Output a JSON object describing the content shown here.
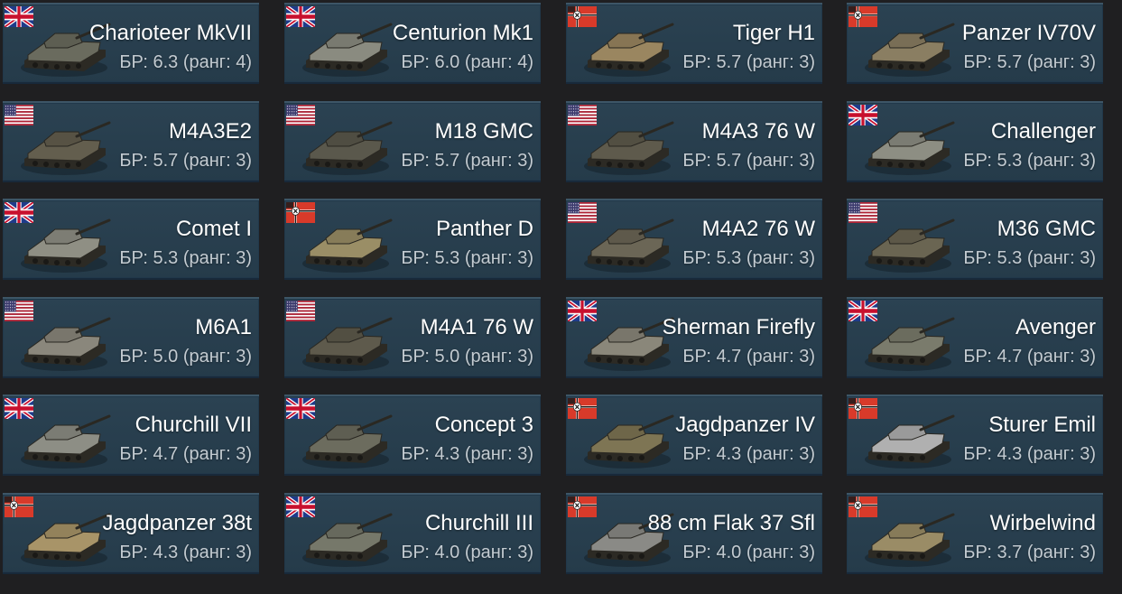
{
  "cards": [
    {
      "name": "Charioteer MkVII",
      "br": "БР: 6.3 (ранг: 4)",
      "nation": "uk",
      "nation_icon": "uk-flag-icon",
      "vehicle_icon": "tank-destroyer-icon",
      "tone": "#6a6b5e"
    },
    {
      "name": "Centurion Mk1",
      "br": "БР: 6.0 (ранг: 4)",
      "nation": "uk",
      "nation_icon": "uk-flag-icon",
      "vehicle_icon": "medium-tank-icon",
      "tone": "#8a8b80"
    },
    {
      "name": "Tiger H1",
      "br": "БР: 5.7 (ранг: 3)",
      "nation": "germany",
      "nation_icon": "german-flag-icon",
      "vehicle_icon": "heavy-tank-icon",
      "tone": "#9a8660"
    },
    {
      "name": "Panzer IV70V",
      "br": "БР: 5.7 (ранг: 3)",
      "nation": "germany",
      "nation_icon": "german-flag-icon",
      "vehicle_icon": "tank-destroyer-icon",
      "tone": "#8a7e62"
    },
    {
      "name": "M4A3E2",
      "br": "БР: 5.7 (ранг: 3)",
      "nation": "usa",
      "nation_icon": "us-flag-icon",
      "vehicle_icon": "heavy-tank-icon",
      "tone": "#635e4e"
    },
    {
      "name": "M18 GMC",
      "br": "БР: 5.7 (ранг: 3)",
      "nation": "usa",
      "nation_icon": "us-flag-icon",
      "vehicle_icon": "tank-destroyer-icon",
      "tone": "#5a584c"
    },
    {
      "name": "M4A3 76 W",
      "br": "БР: 5.7 (ранг: 3)",
      "nation": "usa",
      "nation_icon": "us-flag-icon",
      "vehicle_icon": "medium-tank-icon",
      "tone": "#5e5a4c"
    },
    {
      "name": "Challenger",
      "br": "БР: 5.3 (ранг: 3)",
      "nation": "uk",
      "nation_icon": "uk-flag-icon",
      "vehicle_icon": "tank-destroyer-icon",
      "tone": "#8d8e83"
    },
    {
      "name": "Comet I",
      "br": "БР: 5.3 (ранг: 3)",
      "nation": "uk",
      "nation_icon": "uk-flag-icon",
      "vehicle_icon": "medium-tank-icon",
      "tone": "#8f8f84"
    },
    {
      "name": "Panther D",
      "br": "БР: 5.3 (ранг: 3)",
      "nation": "germany",
      "nation_icon": "german-flag-icon",
      "vehicle_icon": "medium-tank-icon",
      "tone": "#9a8e66"
    },
    {
      "name": "M4A2 76 W",
      "br": "БР: 5.3 (ранг: 3)",
      "nation": "usa",
      "nation_icon": "us-flag-icon",
      "vehicle_icon": "medium-tank-icon",
      "tone": "#6b6656"
    },
    {
      "name": "M36 GMC",
      "br": "БР: 5.3 (ранг: 3)",
      "nation": "usa",
      "nation_icon": "us-flag-icon",
      "vehicle_icon": "tank-destroyer-icon",
      "tone": "#6a6552"
    },
    {
      "name": "M6A1",
      "br": "БР: 5.0 (ранг: 3)",
      "nation": "usa",
      "nation_icon": "us-flag-icon",
      "vehicle_icon": "heavy-tank-icon",
      "tone": "#8a877c"
    },
    {
      "name": "M4A1 76 W",
      "br": "БР: 5.0 (ранг: 3)",
      "nation": "usa",
      "nation_icon": "us-flag-icon",
      "vehicle_icon": "medium-tank-icon",
      "tone": "#5e5a4c"
    },
    {
      "name": "Sherman Firefly",
      "br": "БР: 4.7 (ранг: 3)",
      "nation": "uk",
      "nation_icon": "uk-flag-icon",
      "vehicle_icon": "medium-tank-icon",
      "tone": "#8a877a"
    },
    {
      "name": "Avenger",
      "br": "БР: 4.7 (ранг: 3)",
      "nation": "uk",
      "nation_icon": "uk-flag-icon",
      "vehicle_icon": "tank-destroyer-icon",
      "tone": "#7a7b6c"
    },
    {
      "name": "Churchill VII",
      "br": "БР: 4.7 (ранг: 3)",
      "nation": "uk",
      "nation_icon": "uk-flag-icon",
      "vehicle_icon": "heavy-tank-icon",
      "tone": "#8d8e85"
    },
    {
      "name": "Concept 3",
      "br": "БР: 4.3 (ранг: 3)",
      "nation": "uk",
      "nation_icon": "uk-flag-icon",
      "vehicle_icon": "light-tank-icon",
      "tone": "#6c6c5e"
    },
    {
      "name": "Jagdpanzer IV",
      "br": "БР: 4.3 (ранг: 3)",
      "nation": "germany",
      "nation_icon": "german-flag-icon",
      "vehicle_icon": "tank-destroyer-icon",
      "tone": "#7e7554"
    },
    {
      "name": "Sturer Emil",
      "br": "БР: 4.3 (ранг: 3)",
      "nation": "germany",
      "nation_icon": "german-flag-icon",
      "vehicle_icon": "tank-destroyer-icon",
      "tone": "#b0b0b0"
    },
    {
      "name": "Jagdpanzer 38t",
      "br": "БР: 4.3 (ранг: 3)",
      "nation": "germany",
      "nation_icon": "german-flag-icon",
      "vehicle_icon": "tank-destroyer-icon",
      "tone": "#a89468"
    },
    {
      "name": "Churchill III",
      "br": "БР: 4.0 (ранг: 3)",
      "nation": "uk",
      "nation_icon": "uk-flag-icon",
      "vehicle_icon": "heavy-tank-icon",
      "tone": "#76786a"
    },
    {
      "name": "88 cm Flak 37 Sfl",
      "br": "БР: 4.0 (ранг: 3)",
      "nation": "germany",
      "nation_icon": "german-flag-icon",
      "vehicle_icon": "spaa-icon",
      "tone": "#8a8a86"
    },
    {
      "name": "Wirbelwind",
      "br": "БР: 3.7 (ранг: 3)",
      "nation": "germany",
      "nation_icon": "german-flag-icon",
      "vehicle_icon": "spaa-icon",
      "tone": "#9a8c66"
    }
  ]
}
